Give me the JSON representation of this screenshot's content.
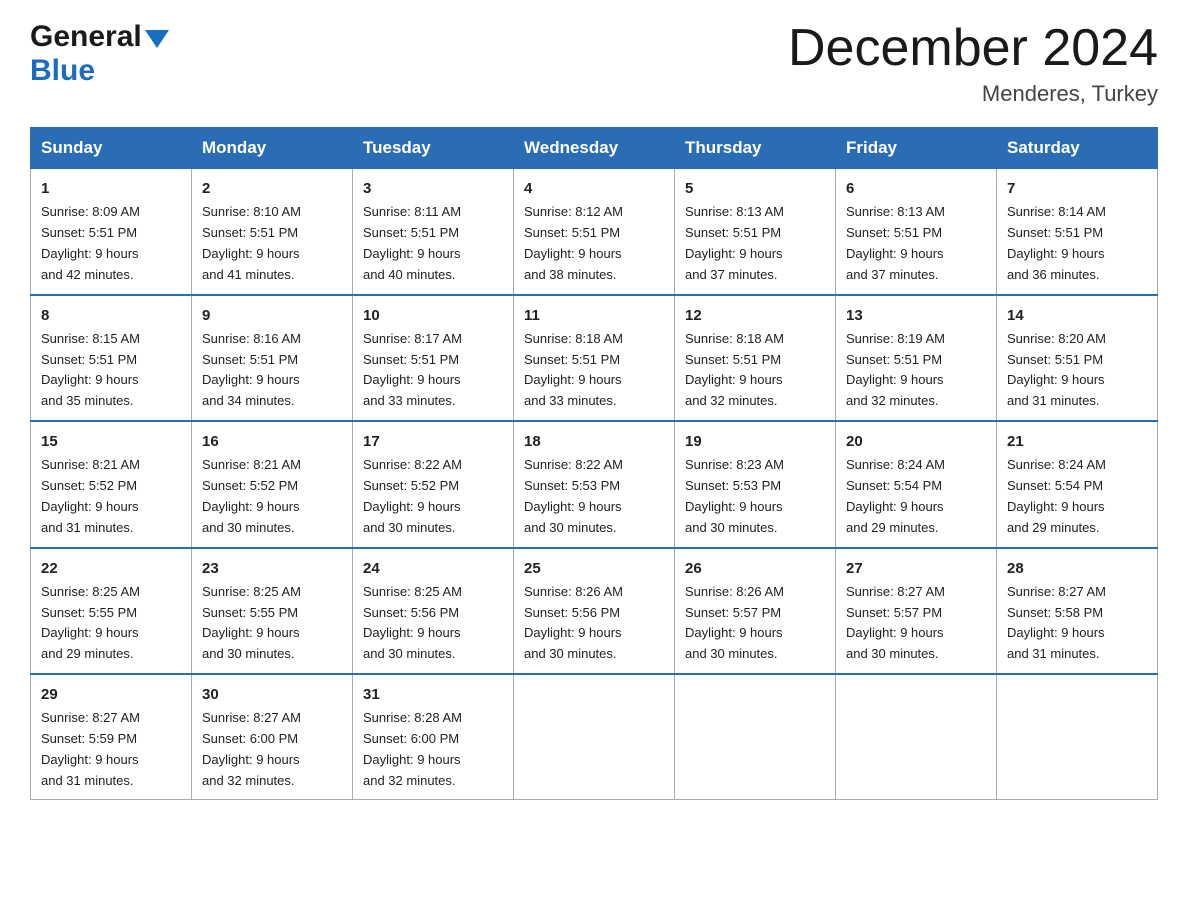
{
  "logo": {
    "line1": "General",
    "arrow": "▼",
    "line2": "Blue"
  },
  "title": {
    "month_year": "December 2024",
    "location": "Menderes, Turkey"
  },
  "days_header": [
    "Sunday",
    "Monday",
    "Tuesday",
    "Wednesday",
    "Thursday",
    "Friday",
    "Saturday"
  ],
  "weeks": [
    [
      {
        "num": "1",
        "sunrise": "8:09 AM",
        "sunset": "5:51 PM",
        "daylight": "9 hours and 42 minutes."
      },
      {
        "num": "2",
        "sunrise": "8:10 AM",
        "sunset": "5:51 PM",
        "daylight": "9 hours and 41 minutes."
      },
      {
        "num": "3",
        "sunrise": "8:11 AM",
        "sunset": "5:51 PM",
        "daylight": "9 hours and 40 minutes."
      },
      {
        "num": "4",
        "sunrise": "8:12 AM",
        "sunset": "5:51 PM",
        "daylight": "9 hours and 38 minutes."
      },
      {
        "num": "5",
        "sunrise": "8:13 AM",
        "sunset": "5:51 PM",
        "daylight": "9 hours and 37 minutes."
      },
      {
        "num": "6",
        "sunrise": "8:13 AM",
        "sunset": "5:51 PM",
        "daylight": "9 hours and 37 minutes."
      },
      {
        "num": "7",
        "sunrise": "8:14 AM",
        "sunset": "5:51 PM",
        "daylight": "9 hours and 36 minutes."
      }
    ],
    [
      {
        "num": "8",
        "sunrise": "8:15 AM",
        "sunset": "5:51 PM",
        "daylight": "9 hours and 35 minutes."
      },
      {
        "num": "9",
        "sunrise": "8:16 AM",
        "sunset": "5:51 PM",
        "daylight": "9 hours and 34 minutes."
      },
      {
        "num": "10",
        "sunrise": "8:17 AM",
        "sunset": "5:51 PM",
        "daylight": "9 hours and 33 minutes."
      },
      {
        "num": "11",
        "sunrise": "8:18 AM",
        "sunset": "5:51 PM",
        "daylight": "9 hours and 33 minutes."
      },
      {
        "num": "12",
        "sunrise": "8:18 AM",
        "sunset": "5:51 PM",
        "daylight": "9 hours and 32 minutes."
      },
      {
        "num": "13",
        "sunrise": "8:19 AM",
        "sunset": "5:51 PM",
        "daylight": "9 hours and 32 minutes."
      },
      {
        "num": "14",
        "sunrise": "8:20 AM",
        "sunset": "5:51 PM",
        "daylight": "9 hours and 31 minutes."
      }
    ],
    [
      {
        "num": "15",
        "sunrise": "8:21 AM",
        "sunset": "5:52 PM",
        "daylight": "9 hours and 31 minutes."
      },
      {
        "num": "16",
        "sunrise": "8:21 AM",
        "sunset": "5:52 PM",
        "daylight": "9 hours and 30 minutes."
      },
      {
        "num": "17",
        "sunrise": "8:22 AM",
        "sunset": "5:52 PM",
        "daylight": "9 hours and 30 minutes."
      },
      {
        "num": "18",
        "sunrise": "8:22 AM",
        "sunset": "5:53 PM",
        "daylight": "9 hours and 30 minutes."
      },
      {
        "num": "19",
        "sunrise": "8:23 AM",
        "sunset": "5:53 PM",
        "daylight": "9 hours and 30 minutes."
      },
      {
        "num": "20",
        "sunrise": "8:24 AM",
        "sunset": "5:54 PM",
        "daylight": "9 hours and 29 minutes."
      },
      {
        "num": "21",
        "sunrise": "8:24 AM",
        "sunset": "5:54 PM",
        "daylight": "9 hours and 29 minutes."
      }
    ],
    [
      {
        "num": "22",
        "sunrise": "8:25 AM",
        "sunset": "5:55 PM",
        "daylight": "9 hours and 29 minutes."
      },
      {
        "num": "23",
        "sunrise": "8:25 AM",
        "sunset": "5:55 PM",
        "daylight": "9 hours and 30 minutes."
      },
      {
        "num": "24",
        "sunrise": "8:25 AM",
        "sunset": "5:56 PM",
        "daylight": "9 hours and 30 minutes."
      },
      {
        "num": "25",
        "sunrise": "8:26 AM",
        "sunset": "5:56 PM",
        "daylight": "9 hours and 30 minutes."
      },
      {
        "num": "26",
        "sunrise": "8:26 AM",
        "sunset": "5:57 PM",
        "daylight": "9 hours and 30 minutes."
      },
      {
        "num": "27",
        "sunrise": "8:27 AM",
        "sunset": "5:57 PM",
        "daylight": "9 hours and 30 minutes."
      },
      {
        "num": "28",
        "sunrise": "8:27 AM",
        "sunset": "5:58 PM",
        "daylight": "9 hours and 31 minutes."
      }
    ],
    [
      {
        "num": "29",
        "sunrise": "8:27 AM",
        "sunset": "5:59 PM",
        "daylight": "9 hours and 31 minutes."
      },
      {
        "num": "30",
        "sunrise": "8:27 AM",
        "sunset": "6:00 PM",
        "daylight": "9 hours and 32 minutes."
      },
      {
        "num": "31",
        "sunrise": "8:28 AM",
        "sunset": "6:00 PM",
        "daylight": "9 hours and 32 minutes."
      },
      null,
      null,
      null,
      null
    ]
  ]
}
